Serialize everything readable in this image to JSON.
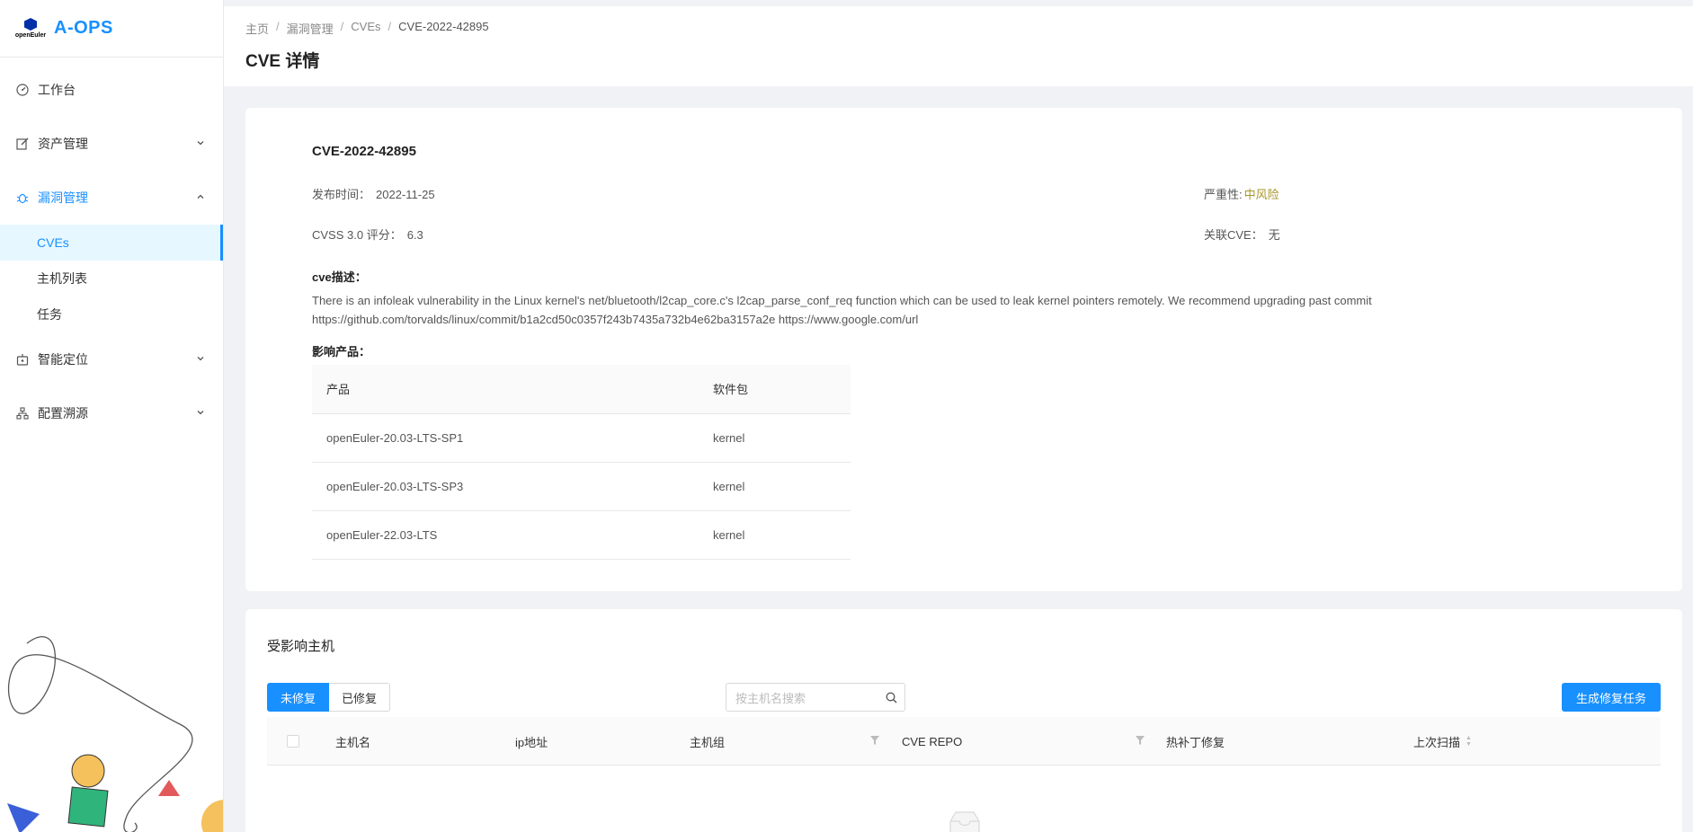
{
  "app": {
    "brand_small": "openEuler",
    "title": "A-OPS"
  },
  "sidebar": {
    "items": [
      {
        "label": "工作台",
        "icon": "dashboard-icon"
      },
      {
        "label": "资产管理",
        "icon": "edit-icon"
      },
      {
        "label": "漏洞管理",
        "icon": "bug-icon"
      },
      {
        "label": "智能定位",
        "icon": "robot-icon"
      },
      {
        "label": "配置溯源",
        "icon": "cluster-icon"
      }
    ],
    "sub_items": [
      {
        "label": "CVEs"
      },
      {
        "label": "主机列表"
      },
      {
        "label": "任务"
      }
    ]
  },
  "breadcrumb": [
    "主页",
    "漏洞管理",
    "CVEs",
    "CVE-2022-42895"
  ],
  "page": {
    "title": "CVE 详情"
  },
  "cve": {
    "id": "CVE-2022-42895",
    "publish_label": "发布时间：",
    "publish_date": "2022-11-25",
    "cvss_label": "CVSS 3.0 评分：",
    "cvss_score": "6.3",
    "severity_label": "严重性:",
    "severity_value": "中风险",
    "severity_color": "#a6962a",
    "related_label": "关联CVE：",
    "related_value": "无",
    "desc_label": "cve描述：",
    "desc_line1": "There is an infoleak vulnerability in the Linux kernel's net/bluetooth/l2cap_core.c's l2cap_parse_conf_req function which can be used to leak kernel pointers remotely. We recommend upgrading past commit",
    "desc_line2": "https://github.com/torvalds/linux/commit/b1a2cd50c0357f243b7435a732b4e62ba3157a2e https://www.google.com/url",
    "products_label": "影响产品：",
    "products_headers": [
      "产品",
      "软件包"
    ],
    "products": [
      [
        "openEuler-20.03-LTS-SP1",
        "kernel"
      ],
      [
        "openEuler-20.03-LTS-SP3",
        "kernel"
      ],
      [
        "openEuler-22.03-LTS",
        "kernel"
      ]
    ]
  },
  "hosts": {
    "title": "受影响主机",
    "tabs": [
      "未修复",
      "已修复"
    ],
    "search_placeholder": "按主机名搜索",
    "generate_button": "生成修复任务",
    "columns": [
      "主机名",
      "ip地址",
      "主机组",
      "CVE REPO",
      "热补丁修复",
      "上次扫描"
    ]
  },
  "colors": {
    "accent": "#1890ff"
  }
}
